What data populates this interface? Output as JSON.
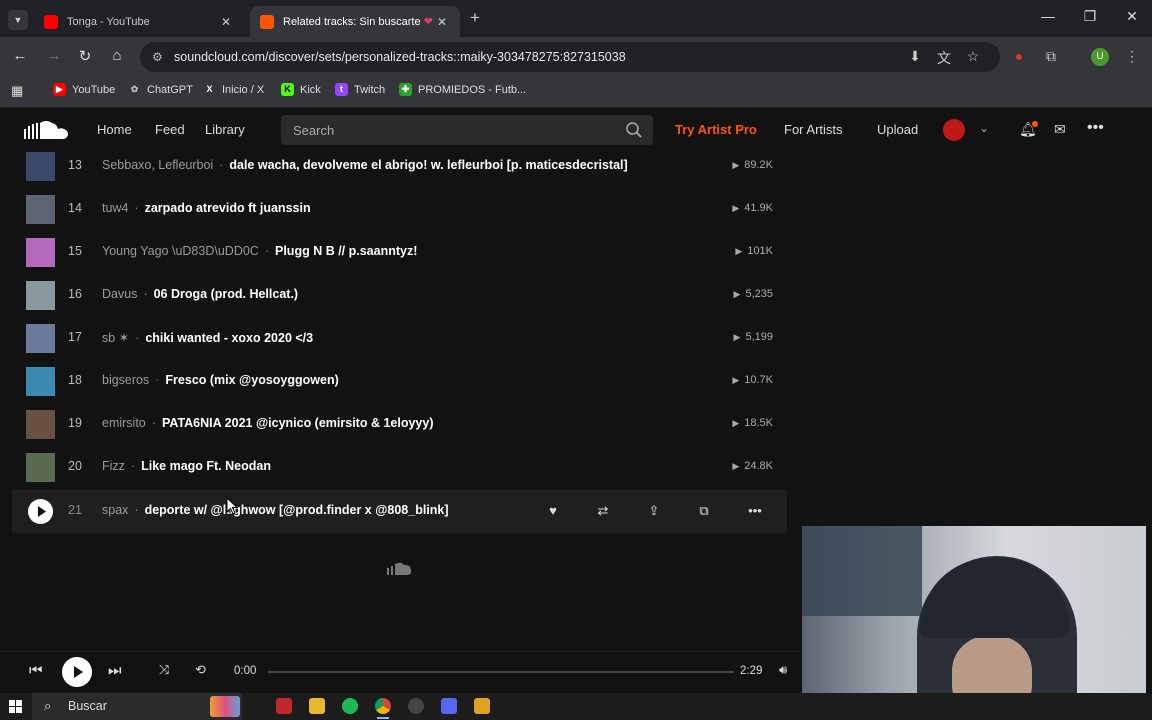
{
  "browser": {
    "tabs": [
      {
        "title": "Tonga - YouTube",
        "active": false,
        "favicon_color": "#ff0000"
      },
      {
        "title": "Related tracks: Sin buscarte",
        "active": true,
        "favicon_color": "#ff5500"
      }
    ],
    "new_tab": "+",
    "url": "soundcloud.com/discover/sets/personalized-tracks::maiky-303478275:827315038",
    "bookmarks": [
      {
        "label": "YouTube",
        "icon": "youtube-icon",
        "color": "#ff0000"
      },
      {
        "label": "ChatGPT",
        "icon": "chatgpt-icon",
        "color": "#bbbbbb"
      },
      {
        "label": "Inicio / X",
        "icon": "x-icon",
        "color": "#ffffff"
      },
      {
        "label": "Kick",
        "icon": "kick-icon",
        "color": "#53fc18"
      },
      {
        "label": "Twitch",
        "icon": "twitch-icon",
        "color": "#9146ff"
      },
      {
        "label": "PROMIEDOS - Futb...",
        "icon": "promiedos-icon",
        "color": "#2ca02c"
      }
    ],
    "profile_initial": "U"
  },
  "soundcloud": {
    "nav": {
      "home": "Home",
      "feed": "Feed",
      "library": "Library"
    },
    "search_placeholder": "Search",
    "try_pro": "Try Artist Pro",
    "for_artists": "For Artists",
    "upload": "Upload",
    "accent": "#ff5500"
  },
  "tracks": [
    {
      "num": "13",
      "artist": "Sebbaxo, Lefleurboi",
      "title": "dale wacha, devolveme el abrigo! w. lefleurboi [p. maticesdecristal]",
      "plays": "89.2K",
      "thumb": "#3a4a6a"
    },
    {
      "num": "14",
      "artist": "tuw4",
      "title": "zarpado atrevido ft juanssin",
      "plays": "41.9K",
      "thumb": "#5b6470"
    },
    {
      "num": "15",
      "artist": "Young Yago \\uD83D\\uDD0C",
      "title": "Plugg N B // p.saanntyz!",
      "plays": "101K",
      "thumb": "#b36ab8"
    },
    {
      "num": "16",
      "artist": "Davus",
      "title": "06 Droga (prod. Hellcat.)",
      "plays": "5,235",
      "thumb": "#8a9aa0"
    },
    {
      "num": "17",
      "artist": "sb ✶",
      "title": "chiki wanted - xoxo 2020 </3",
      "plays": "5,199",
      "thumb": "#6a7a9a"
    },
    {
      "num": "18",
      "artist": "bigseros",
      "title": "Fresco (mix @yosoyggowen)",
      "plays": "10.7K",
      "thumb": "#3a8ab0"
    },
    {
      "num": "19",
      "artist": "emirsito",
      "title": "PATA6NIA 2021 @icynico (emirsito & 1eloyyy)",
      "plays": "18.5K",
      "thumb": "#6a5040"
    },
    {
      "num": "20",
      "artist": "Fizz",
      "title": "Like mago Ft. Neodan",
      "plays": "24.8K",
      "thumb": "#5a6a50"
    },
    {
      "num": "21",
      "artist": "spax",
      "title": "deporte w/ @laghwow [@prod.finder x @808_blink]",
      "plays": "",
      "thumb": "#ffffff"
    }
  ],
  "player": {
    "current": "0:00",
    "duration": "2:29",
    "progress": 0.0
  },
  "taskbar": {
    "search_label": "Buscar"
  }
}
